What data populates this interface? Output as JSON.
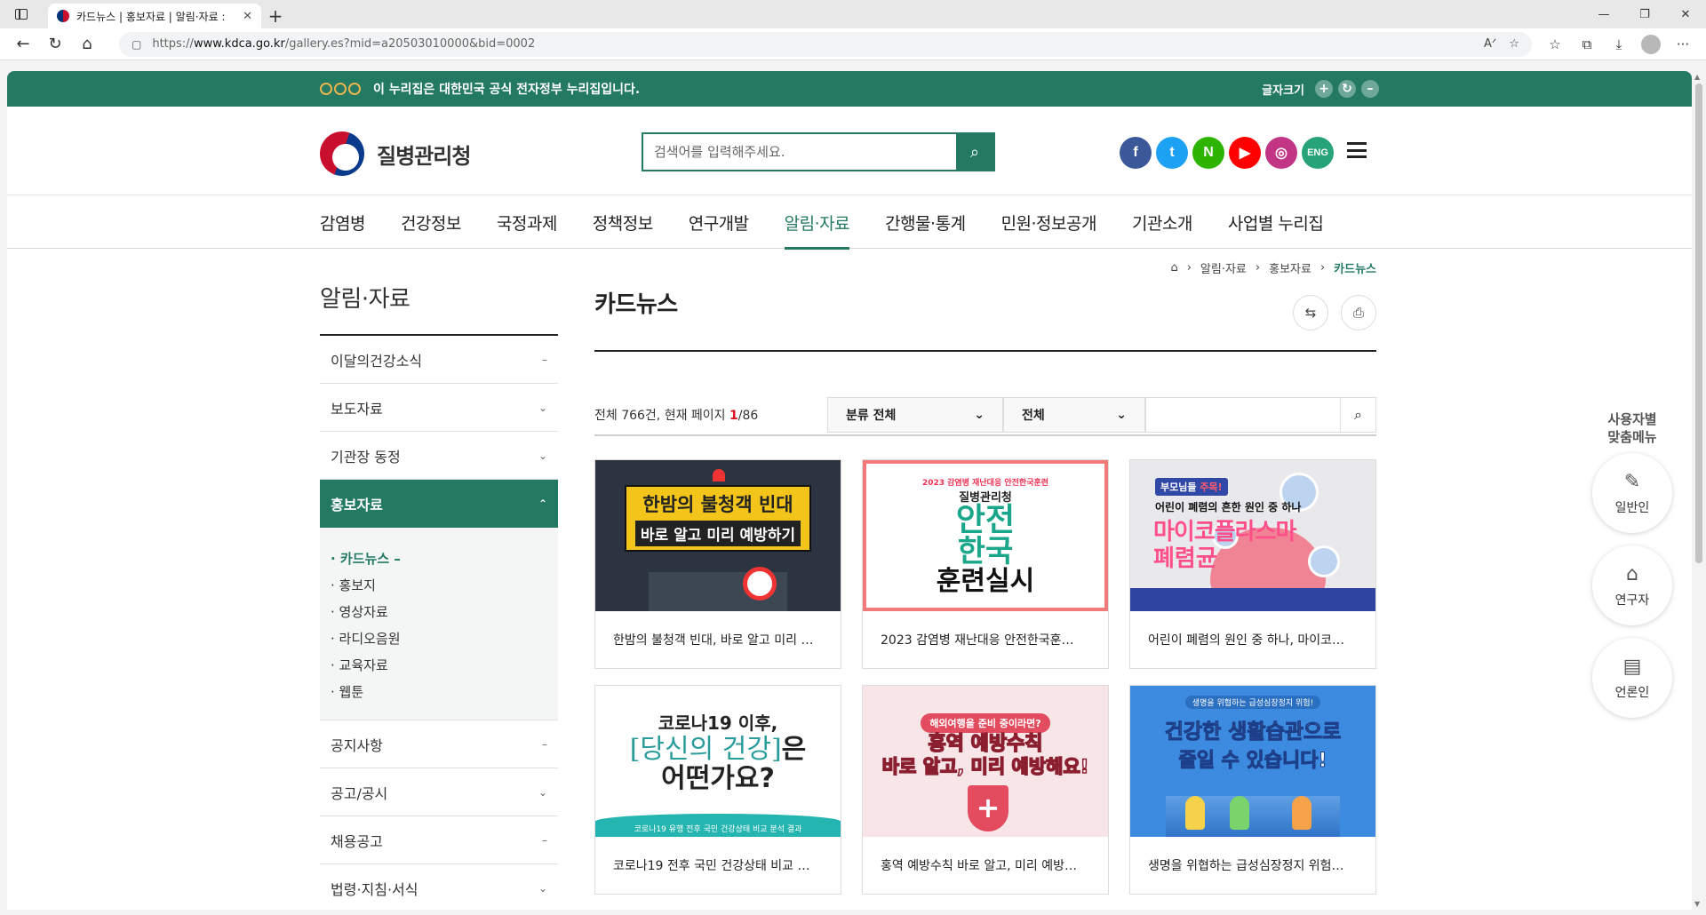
{
  "browser": {
    "tab_title": "카드뉴스 | 홍보자료 | 알림·자료 :",
    "url_prefix": "https://",
    "url_host": "www.kdca.go.kr",
    "url_path": "/gallery.es?mid=a20503010000&bid=0002"
  },
  "gov_banner": {
    "text": "이 누리집은 대한민국 공식 전자정부 누리집입니다.",
    "font_size_label": "글자크기"
  },
  "header": {
    "logo_text": "질병관리청",
    "search_placeholder": "검색어를 입력해주세요.",
    "eng_label": "ENG"
  },
  "gnb": [
    "감염병",
    "건강정보",
    "국정과제",
    "정책정보",
    "연구개발",
    "알림·자료",
    "간행물·통계",
    "민원·정보공개",
    "기관소개",
    "사업별 누리집"
  ],
  "lnb": {
    "title": "알림·자료",
    "items_top": [
      {
        "label": "이달의건강소식",
        "ind": "–"
      },
      {
        "label": "보도자료",
        "ind": "⌄"
      },
      {
        "label": "기관장 동정",
        "ind": "⌄"
      }
    ],
    "active": {
      "label": "홍보자료",
      "ind": "⌃"
    },
    "sub": [
      "· 카드뉴스 –",
      "· 홍보지",
      "· 영상자료",
      "· 라디오음원",
      "· 교육자료",
      "· 웹툰"
    ],
    "items_bottom": [
      {
        "label": "공지사항",
        "ind": "–"
      },
      {
        "label": "공고/공시",
        "ind": "⌄"
      },
      {
        "label": "채용공고",
        "ind": "–"
      },
      {
        "label": "법령·지침·서식",
        "ind": "⌄"
      }
    ]
  },
  "main": {
    "breadcrumb": [
      "알림·자료",
      "홍보자료",
      "카드뉴스"
    ],
    "title": "카드뉴스",
    "count_prefix": "전체 766건, 현재 페이지 ",
    "count_page": "1",
    "count_total": "/86",
    "select1": "분류 전체",
    "select2": "전체"
  },
  "cards": [
    {
      "caption": "한밤의 불청객 빈대, 바로 알고 미리 …",
      "thumb": {
        "line1": "한밤의 불청객 빈대",
        "line2": "바로 알고 미리 예방하기"
      }
    },
    {
      "caption": "2023 감염병 재난대응 안전한국훈…",
      "thumb": {
        "small": "2023 감염병 재난대응 안전한국훈련",
        "org": "질병관리청",
        "big1": "안전",
        "big2": "한국",
        "big3": "훈련실시"
      }
    },
    {
      "caption": "어린이 폐렴의 원인 중 하나, 마이코…",
      "thumb": {
        "tag_a": "부모님들 ",
        "tag_b": "주목!",
        "sub": "어린이 폐렴의 흔한 원인 중 하나",
        "m1": "마이코플라스마",
        "m2": "폐렴균"
      }
    },
    {
      "caption": "코로나19 전후 국민 건강상태 비교 …",
      "thumb": {
        "a": "코로나19 이후,",
        "b": "[당신의 건강]",
        "b_rest": "은",
        "c": "어떤가요?",
        "band": "코로나19 유행 전후 국민 건강상태 비교 분석 결과"
      }
    },
    {
      "caption": "홍역 예방수칙 바로 알고, 미리 예방…",
      "thumb": {
        "pill": "해외여행을 준비 중이라면?",
        "l1": "홍역 예방수칙",
        "l2": "바로 알고, 미리 예방해요!"
      }
    },
    {
      "caption": "생명을 위협하는 급성심장정지 위험…",
      "thumb": {
        "sm": "생명을 위협하는 급성심장정지 위험!",
        "l1a": "건강한 ",
        "l1b": "생활습관",
        "l1c": "으로",
        "l2": "줄일 수 있습니다!"
      }
    }
  ],
  "side_menu": {
    "title_line1": "사용자별",
    "title_line2": "맞춤메뉴",
    "items": [
      "일반인",
      "연구자",
      "언론인"
    ]
  },
  "colors": {
    "brand": "#237962",
    "facebook": "#3b5998",
    "twitter": "#1da1f2",
    "naver": "#2db400",
    "youtube": "#ff0000",
    "instagram": "#c13584",
    "eng": "#27a37a"
  }
}
